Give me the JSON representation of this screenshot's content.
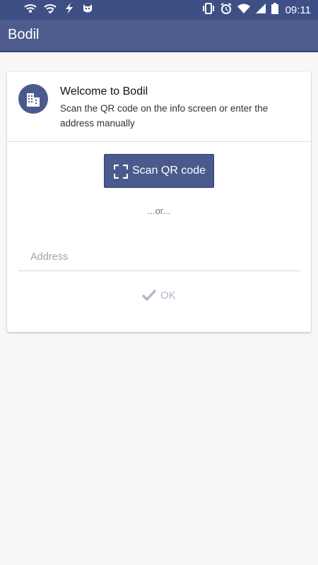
{
  "status_bar": {
    "time": "09:11",
    "left_icons": [
      "wifi-warning-icon",
      "wifi-check-icon",
      "flash-icon",
      "cat-icon"
    ],
    "right_icons": [
      "vibrate-icon",
      "alarm-icon",
      "wifi-icon",
      "signal-icon",
      "battery-icon"
    ]
  },
  "app_bar": {
    "title": "Bodil"
  },
  "card": {
    "icon": "building-icon",
    "title": "Welcome to Bodil",
    "description": "Scan the QR code on the info screen or enter the address manually"
  },
  "scan_button": {
    "label": "Scan QR code",
    "icon": "qr-scan-icon"
  },
  "separator_text": "...or...",
  "address_input": {
    "placeholder": "Address",
    "value": ""
  },
  "ok_button": {
    "label": "OK",
    "icon": "check-icon",
    "enabled": false
  },
  "colors": {
    "primary": "#4d5c8d",
    "status_bar": "#3e4f86",
    "accent_button": "#4a5a8c",
    "disabled": "#b0b7c9"
  }
}
